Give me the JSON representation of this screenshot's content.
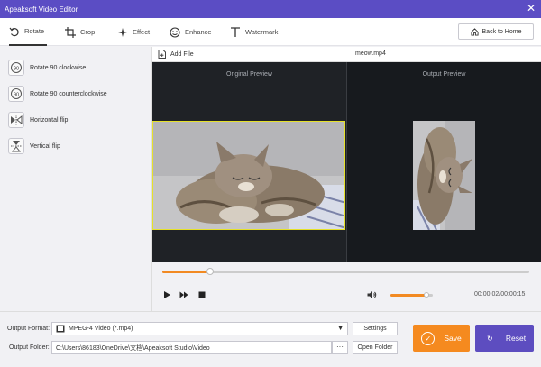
{
  "window": {
    "title": "Apeaksoft Video Editor",
    "close_symbol": "✕"
  },
  "tabs": [
    {
      "label": "Rotate",
      "icon": "rotate-icon",
      "active": true
    },
    {
      "label": "Crop",
      "icon": "crop-icon"
    },
    {
      "label": "Effect",
      "icon": "effect-icon"
    },
    {
      "label": "Enhance",
      "icon": "enhance-icon"
    },
    {
      "label": "Watermark",
      "icon": "watermark-icon"
    }
  ],
  "back_home_label": "Back to Home",
  "rotate_options": [
    {
      "label": "Rotate 90 clockwise",
      "icon_text": "90"
    },
    {
      "label": "Rotate 90 counterclockwise",
      "icon_text": "90"
    },
    {
      "label": "Horizontal flip"
    },
    {
      "label": "Vertical flip"
    }
  ],
  "file": {
    "add_label": "Add File",
    "name": "meow.mp4"
  },
  "preview": {
    "original_label": "Original Preview",
    "output_label": "Output Preview"
  },
  "playback": {
    "progress": 0.13,
    "volume": 0.85,
    "timecode": "00:00:02/00:00:15"
  },
  "output": {
    "format_label": "Output Format:",
    "format_value": "MPEG-4 Video (*.mp4)",
    "folder_label": "Output Folder:",
    "folder_path": "C:\\Users\\86183\\OneDrive\\文档\\Apeaksoft Studio\\Video",
    "settings_label": "Settings",
    "open_folder_label": "Open Folder",
    "browse_label": "···"
  },
  "actions": {
    "save_label": "Save",
    "reset_label": "Reset"
  },
  "colors": {
    "accent_purple": "#5b4dc4",
    "accent_orange": "#f58a1f",
    "crop_yellow": "#e6e12a"
  }
}
